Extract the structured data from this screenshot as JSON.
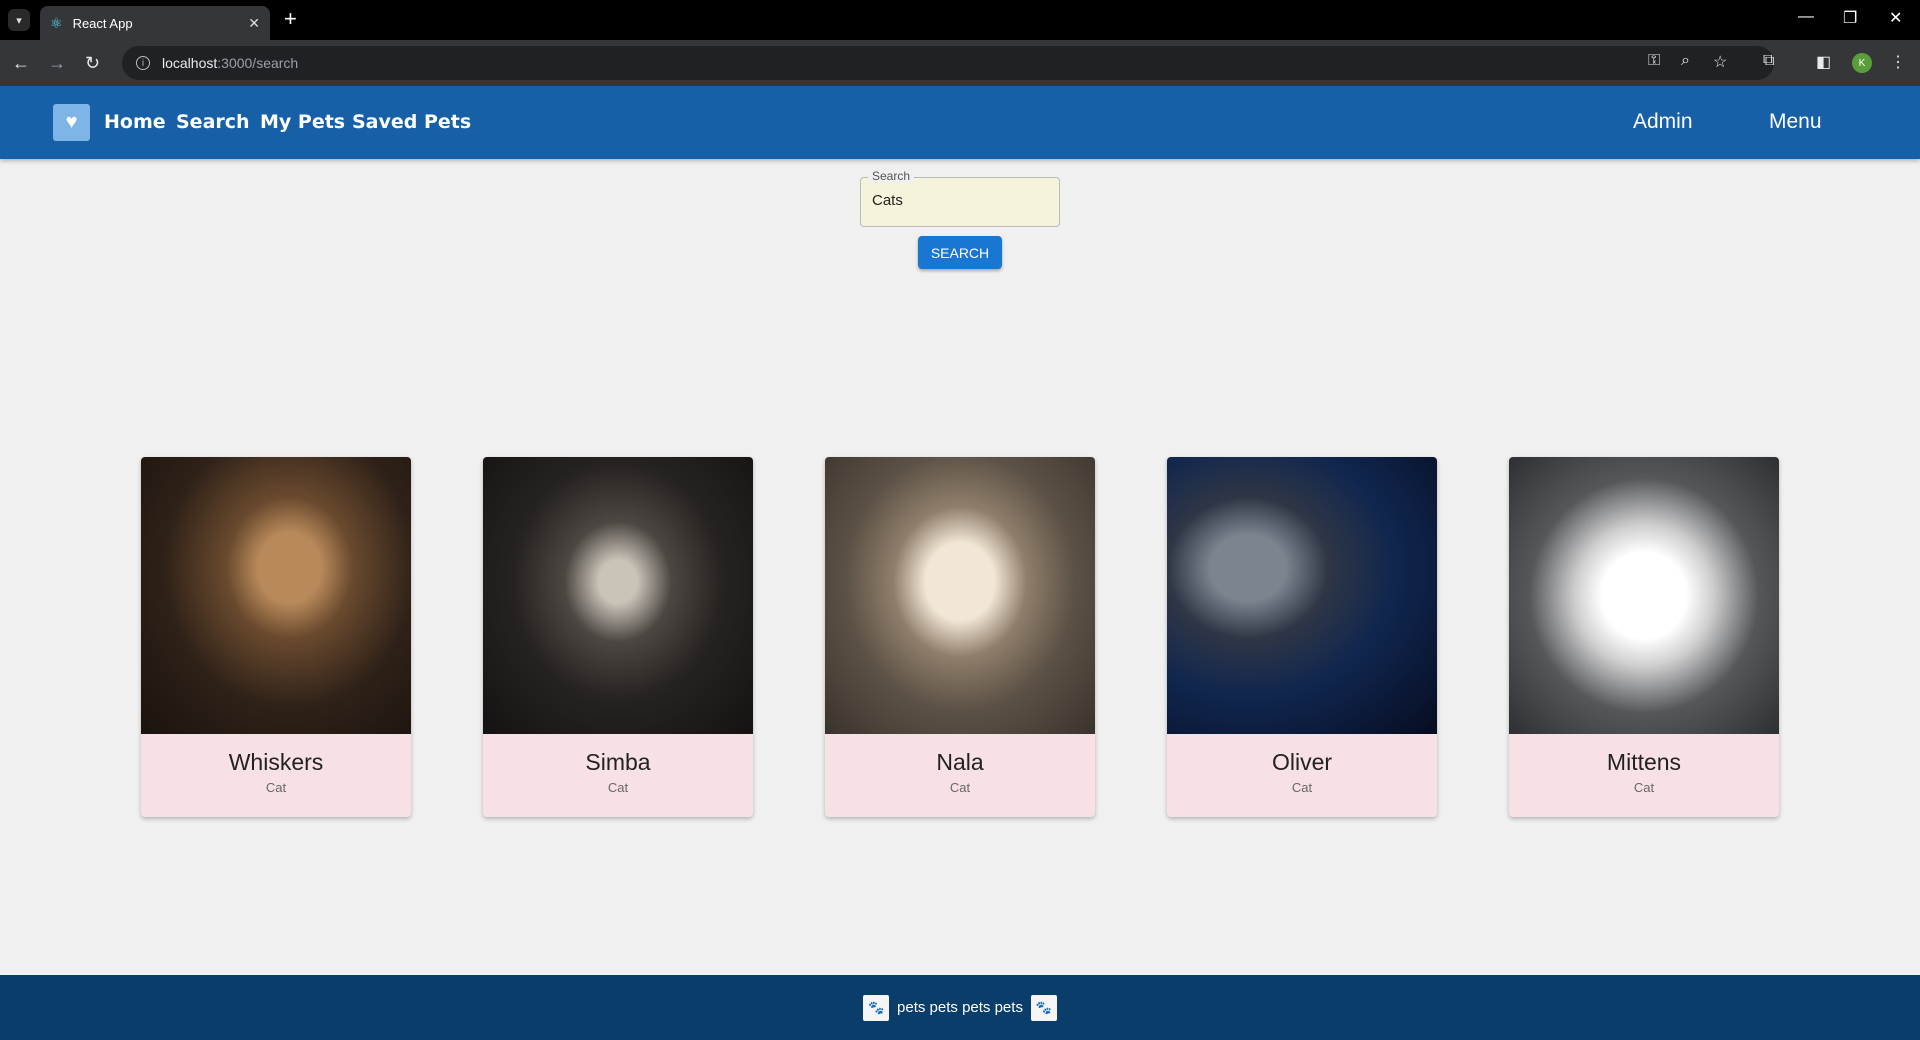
{
  "browser": {
    "tab_title": "React App",
    "url_host": "localhost",
    "url_path": ":3000/search"
  },
  "nav": {
    "home": "Home",
    "search": "Search",
    "my_pets": "My Pets",
    "saved_pets": "Saved Pets",
    "admin": "Admin",
    "menu": "Menu"
  },
  "search": {
    "label": "Search",
    "value": "Cats",
    "button": "SEARCH"
  },
  "results": [
    {
      "name": "Whiskers",
      "type": "Cat"
    },
    {
      "name": "Simba",
      "type": "Cat"
    },
    {
      "name": "Nala",
      "type": "Cat"
    },
    {
      "name": "Oliver",
      "type": "Cat"
    },
    {
      "name": "Mittens",
      "type": "Cat"
    }
  ],
  "footer": {
    "text": "pets pets pets pets"
  }
}
